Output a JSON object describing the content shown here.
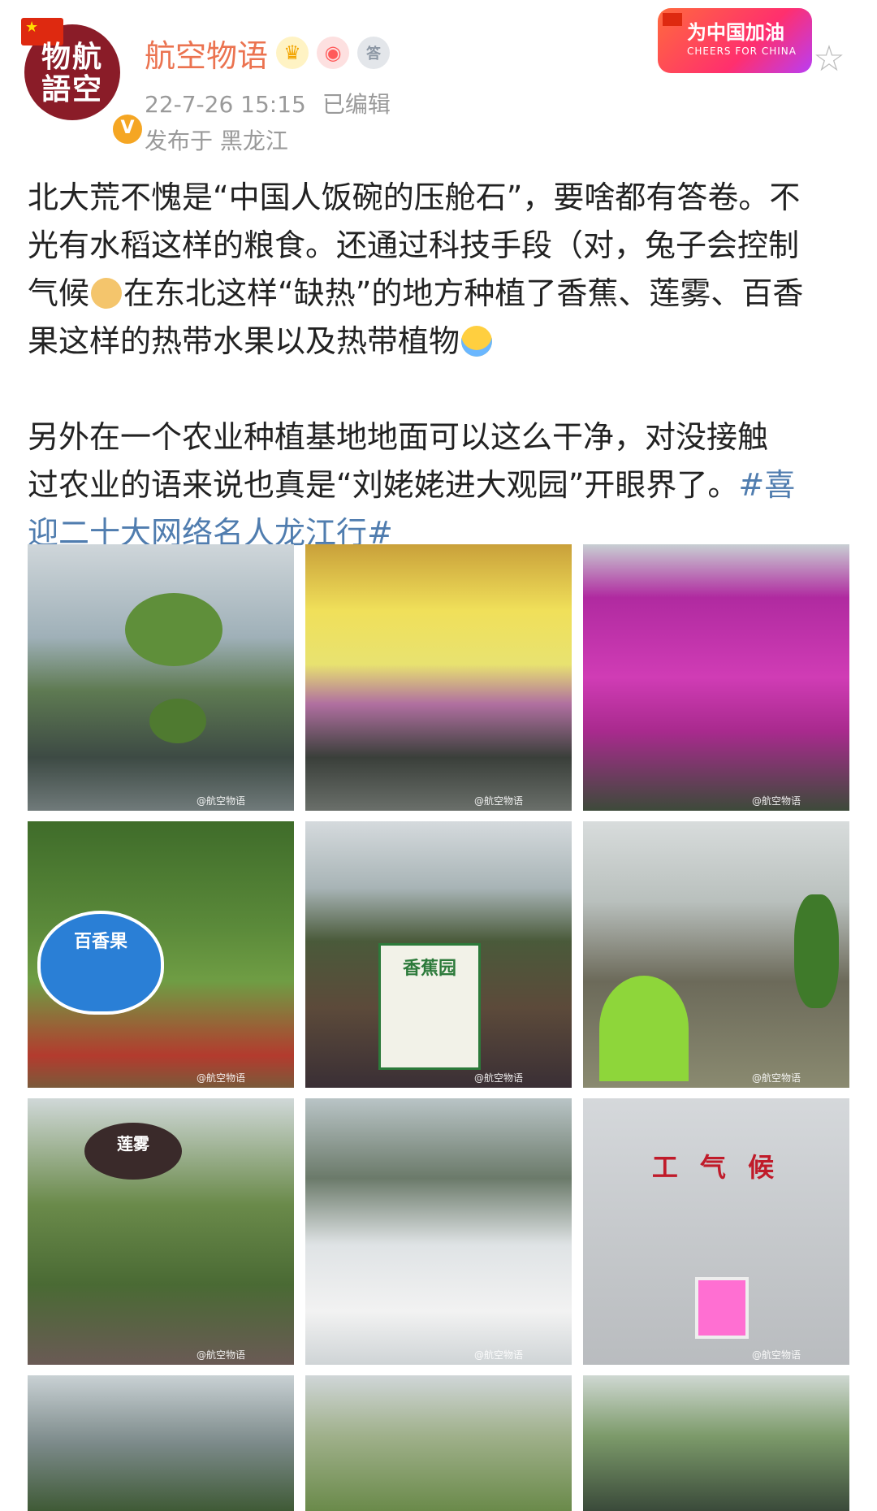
{
  "user": {
    "name": "航空物语",
    "avatar_text": "物航\n語空",
    "verified_mark": "V"
  },
  "meta": {
    "time": "22-7-26 15:15",
    "edited": "已编辑",
    "location": "发布于 黑龙江"
  },
  "promo": {
    "title": "为中国加油",
    "subtitle": "CHEERS FOR CHINA"
  },
  "post": {
    "line1": "北大荒不愧是“中国人饭碗的压舱石”，要啥都有答卷。不",
    "line2": "光有水稻这样的粮食。还通过科技手段（对，兔子会控制",
    "line3a": "气候",
    "line3b": "在东北这样“缺热”的地方种植了香蕉、莲雾、百香",
    "line4": "果这样的热带水果以及热带植物",
    "line5": "另外在一个农业种植基地地面可以这么干净，对没接触",
    "line6a": "过农业的语来说也真是“刘姥姥进大观园”开眼界了。",
    "hashtag_a": "#喜",
    "hashtag_b": "迎二十大网络名人龙江行#"
  },
  "images": [
    {
      "watermark": "@航空物语"
    },
    {
      "watermark": "@航空物语"
    },
    {
      "watermark": "@航空物语"
    },
    {
      "watermark": "@航空物语",
      "sign": "百香果"
    },
    {
      "watermark": "@航空物语",
      "sign": "香蕉园"
    },
    {
      "watermark": "@航空物语"
    },
    {
      "watermark": "@航空物语",
      "sign": "莲雾"
    },
    {
      "watermark": "@航空物语"
    },
    {
      "watermark": "@航空物语",
      "sign": "工 气 候"
    },
    {
      "watermark": ""
    },
    {
      "watermark": ""
    },
    {
      "watermark": ""
    }
  ],
  "colors": {
    "username": "#eb7350",
    "hashtag": "#507daf",
    "meta": "#9a9a9a"
  }
}
